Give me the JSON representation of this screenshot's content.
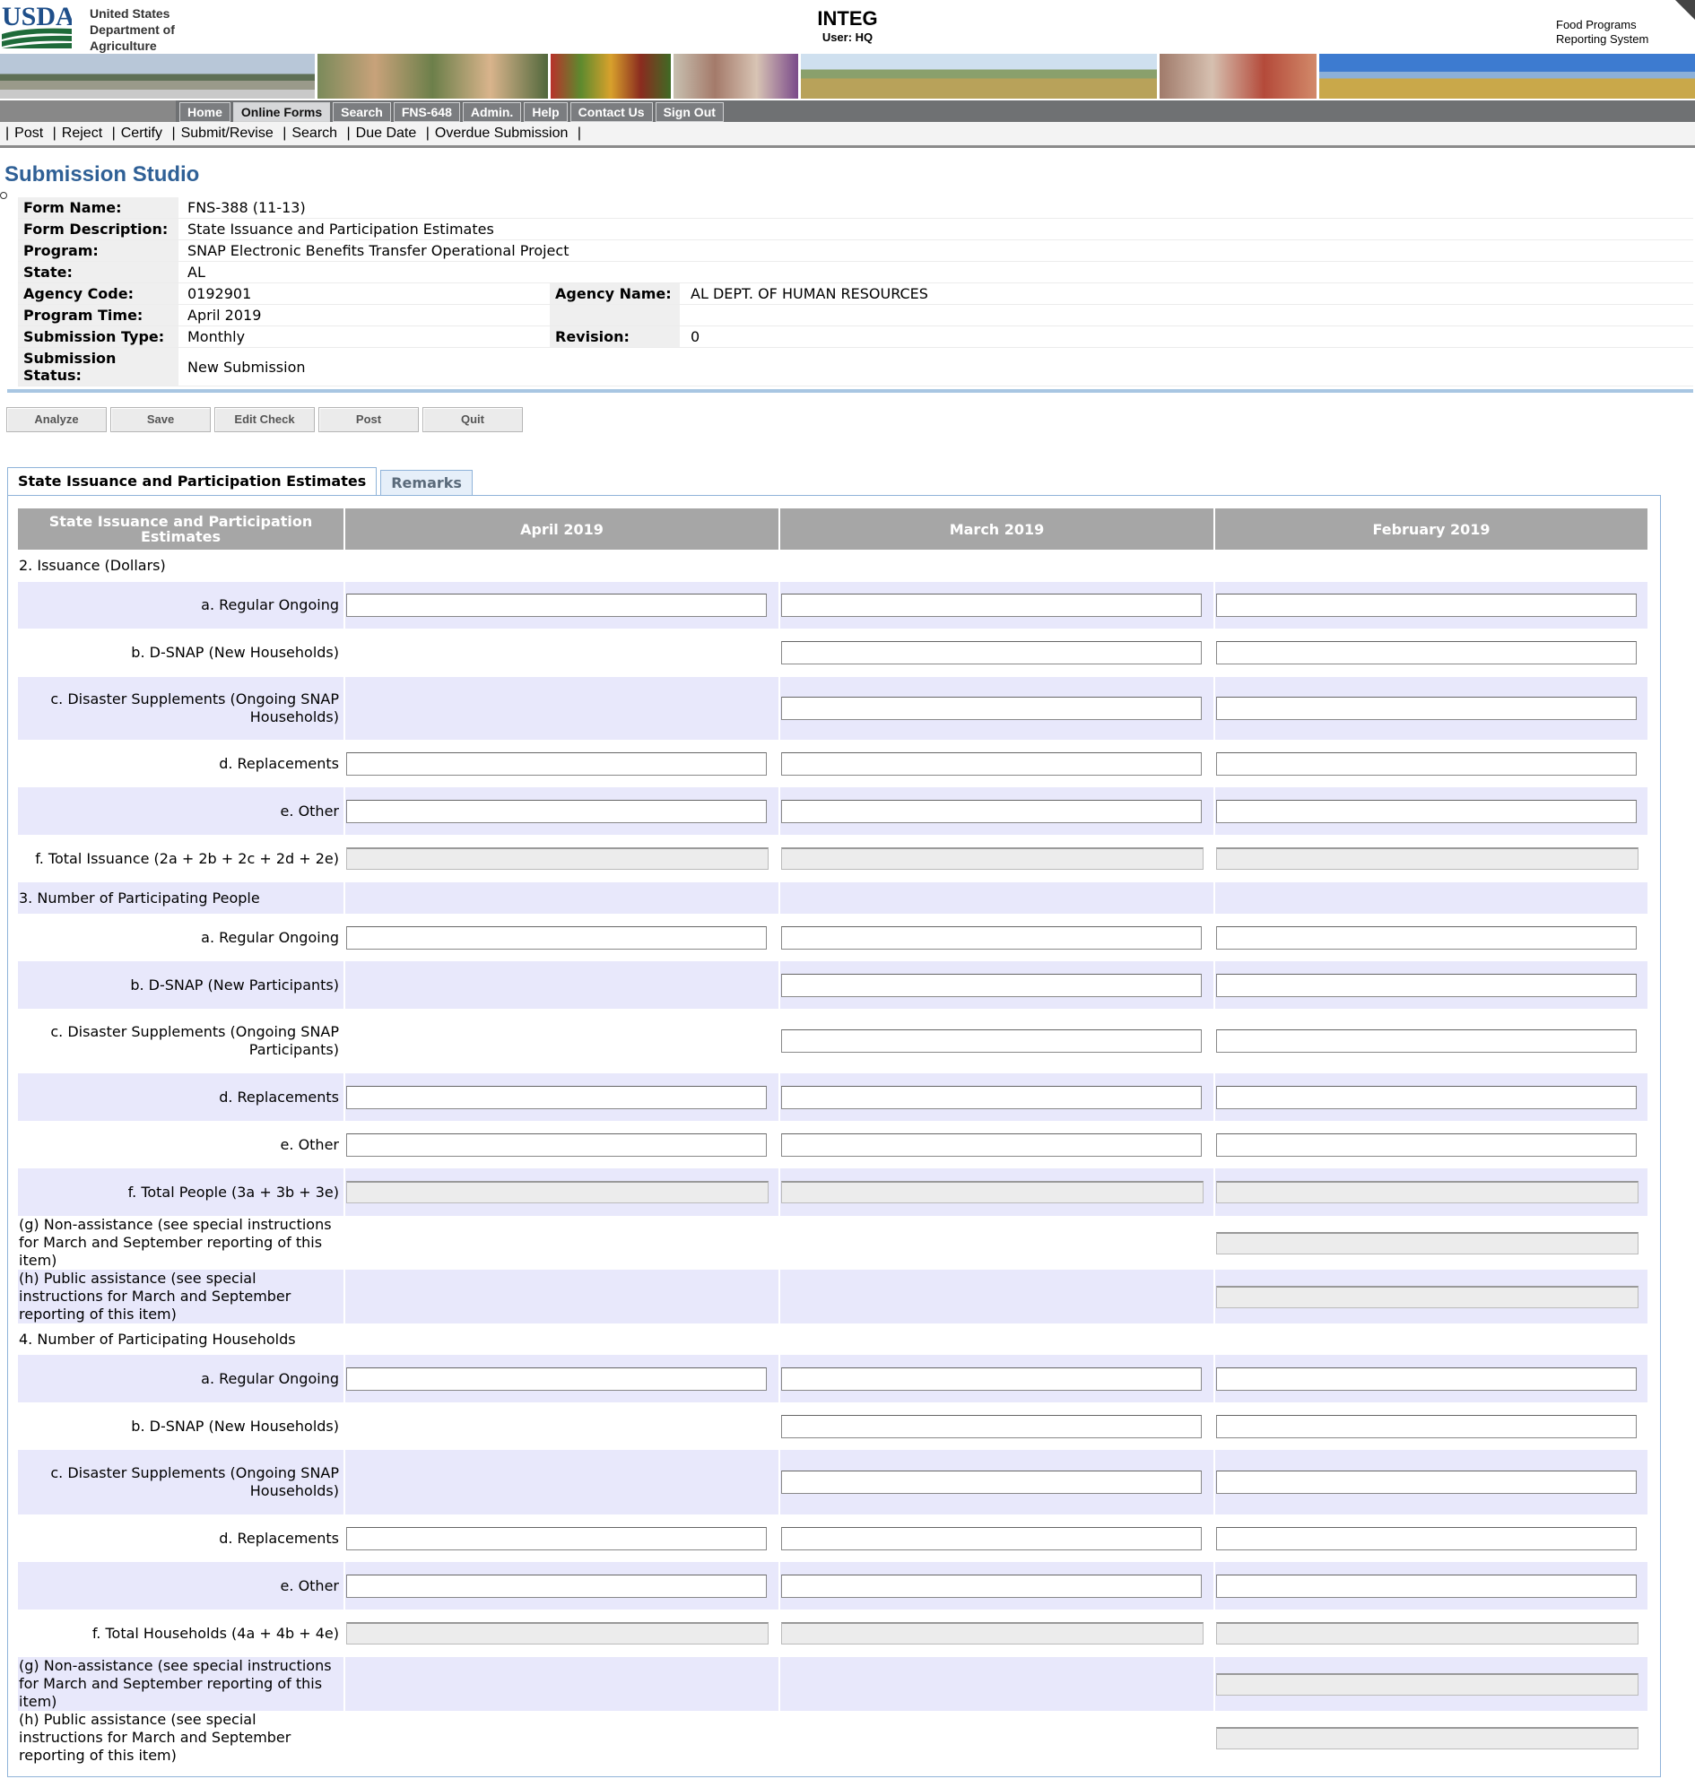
{
  "header": {
    "logo_text": "USDA",
    "org_lines": [
      "United States",
      "Department of",
      "Agriculture"
    ],
    "app_title": "INTEG",
    "user_label": "User: HQ",
    "system_lines": [
      "Food Programs",
      "Reporting System"
    ]
  },
  "nav": {
    "tabs": [
      "Home",
      "Online Forms",
      "Search",
      "FNS-648",
      "Admin.",
      "Help",
      "Contact Us",
      "Sign Out"
    ],
    "active": "Online Forms"
  },
  "subnav": {
    "items": [
      "Post",
      "Reject",
      "Certify",
      "Submit/Revise",
      "Search",
      "Due Date",
      "Overdue Submission"
    ]
  },
  "page_title": "Submission Studio",
  "meta": {
    "form_name_label": "Form Name:",
    "form_name": "FNS-388 (11-13)",
    "form_desc_label": "Form Description:",
    "form_desc": "State Issuance and Participation Estimates",
    "program_label": "Program:",
    "program": "SNAP Electronic Benefits Transfer Operational Project",
    "state_label": "State:",
    "state": "AL",
    "agency_code_label": "Agency Code:",
    "agency_code": "0192901",
    "agency_name_label": "Agency Name:",
    "agency_name": "AL DEPT. OF HUMAN RESOURCES",
    "program_time_label": "Program Time:",
    "program_time": "April 2019",
    "submission_type_label": "Submission Type:",
    "submission_type": "Monthly",
    "revision_label": "Revision:",
    "revision": "0",
    "status_label_1": "Submission",
    "status_label_2": "Status:",
    "status": "New Submission"
  },
  "buttons": [
    "Analyze",
    "Save",
    "Edit Check",
    "Post",
    "Quit"
  ],
  "tabs": [
    "State Issuance and Participation Estimates",
    "Remarks"
  ],
  "table": {
    "col0_line1": "State Issuance and Participation",
    "col0_line2": "Estimates",
    "months": [
      "April 2019",
      "March 2019",
      "February 2019"
    ],
    "sections": {
      "s2": "2. Issuance (Dollars)",
      "s3": "3. Number of Participating People",
      "s4": "4. Number of Participating Households"
    },
    "labels": {
      "r2a": "a. Regular Ongoing",
      "r2b": "b. D-SNAP (New Households)",
      "r2c1": "c. Disaster Supplements (Ongoing SNAP",
      "r2c2": "Households)",
      "r2d": "d. Replacements",
      "r2e": "e. Other",
      "r2f": "f. Total Issuance (2a + 2b + 2c + 2d + 2e)",
      "r3a": "a. Regular Ongoing",
      "r3b": "b. D-SNAP (New Participants)",
      "r3c1": "c. Disaster Supplements (Ongoing SNAP",
      "r3c2": "Participants)",
      "r3d": "d. Replacements",
      "r3e": "e. Other",
      "r3f": "f. Total People (3a + 3b + 3e)",
      "r3g1": "(g) Non-assistance (see special instructions",
      "r3g2": "for March and September reporting of this",
      "r3g3": "item)",
      "r3h1": "(h) Public assistance (see special",
      "r3h2": "instructions for March and September",
      "r3h3": "reporting of this item)",
      "r4a": "a. Regular Ongoing",
      "r4b": "b. D-SNAP (New Households)",
      "r4c1": "c. Disaster Supplements (Ongoing SNAP",
      "r4c2": "Households)",
      "r4d": "d. Replacements",
      "r4e": "e. Other",
      "r4f": "f. Total Households (4a + 4b + 4e)",
      "r4g1": "(g) Non-assistance (see special instructions",
      "r4g2": "for March and September reporting of this",
      "r4g3": "item)",
      "r4h1": "(h) Public assistance (see special",
      "r4h2": "instructions for March and September",
      "r4h3": "reporting of this item)"
    }
  },
  "colors": {
    "title_blue": "#2f6096",
    "nav_gray": "#6f7173",
    "header_gray": "#a6a6a6",
    "row_alt": "#e8e8fb",
    "usda_green": "#1f6b3a"
  }
}
